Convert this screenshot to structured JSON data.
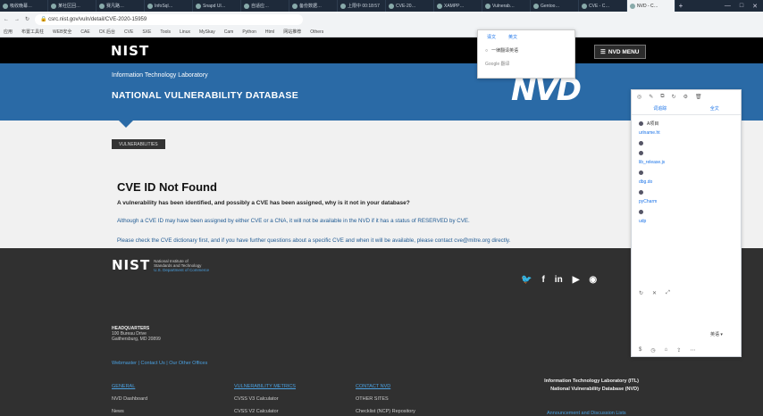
{
  "browser": {
    "tabs": [
      {
        "label": "吸收晚幕…"
      },
      {
        "label": "某社区回…"
      },
      {
        "label": "赛凡路…"
      },
      {
        "label": "InfoSql…"
      },
      {
        "label": "Snapd Ul…"
      },
      {
        "label": "自适应…"
      },
      {
        "label": "备份数据…"
      },
      {
        "label": "上限中 00:18:57"
      },
      {
        "label": "CVE-20…"
      },
      {
        "label": "XAMPP…"
      },
      {
        "label": "Vulnerab…"
      },
      {
        "label": "Gentoo…"
      },
      {
        "label": "CVE - C…"
      },
      {
        "label": "NVD - C…"
      }
    ],
    "new_tab": "+",
    "url": "csrc.nist.gov/vuln/detail/CVE-2020-15959",
    "bookmarks": [
      "应用",
      "布置工具柱",
      "WEB安全",
      "CAE",
      "CK 后台",
      "CVE",
      "SXE",
      "Tools",
      "Linux",
      "MySkay",
      "Cam",
      "Python",
      "Html",
      "网站推荐",
      "Others"
    ]
  },
  "site": {
    "logo": "NIST",
    "menu_label": "NVD MENU",
    "itl_label": "Information Technology Laboratory",
    "nvd_title": "NATIONAL VULNERABILITY DATABASE",
    "nvd_logo": "NVD",
    "vuln_button": "VULNERABILITIES"
  },
  "main": {
    "heading": "CVE ID Not Found",
    "lead": "A vulnerability has been identified, and possibly a CVE has been assigned, why is it not in your database?",
    "para1": "Although a CVE ID may have been assigned by either CVE or a CNA, it will not be available in the NVD if it has a status of RESERVED by CVE.",
    "para2": "Please check the CVE dictionary first, and if you have further questions about a specific CVE and when it will be available, please contact cve@mitre.org directly."
  },
  "footer": {
    "logo": "NIST",
    "logo_sub1": "National Institute of",
    "logo_sub2": "Standards and Technology",
    "logo_sub3": "U.S. Department of Commerce",
    "social": [
      "twitter",
      "facebook",
      "linkedin",
      "youtube",
      "rss"
    ],
    "hq_label": "HEADQUARTERS",
    "hq_line1": "100 Bureau Drive",
    "hq_line2": "Gaithersburg, MD 20899",
    "links": "Webmaster | Contact Us | Our Other Offices",
    "col1": {
      "head": "GENERAL",
      "items": [
        "NVD Dashboard",
        "News"
      ]
    },
    "col2": {
      "head": "VULNERABILITY METRICS",
      "items": [
        "CVSS V3 Calculator",
        "CVSS V2 Calculator"
      ]
    },
    "col3": {
      "head": "CONTACT NVD",
      "items": [
        "OTHER SITES",
        "Checklist (NCP) Repository"
      ]
    },
    "right1": "Information Technology Laboratory (ITL)",
    "right2": "National Vulnerability Database (NVD)",
    "accessibility": "Announcement and Discussion Lists"
  },
  "popup": {
    "tabs": [
      "译文",
      "英文"
    ],
    "item": "一律翻译英语",
    "footer": "Google 翻译"
  },
  "panel": {
    "tab1": "词追踪",
    "tab2": "全文",
    "entries": [
      "A项目",
      "urlname.ht",
      "lib_release.js",
      "dbg.do",
      "pyCharm",
      "udp"
    ],
    "select": "英语"
  }
}
